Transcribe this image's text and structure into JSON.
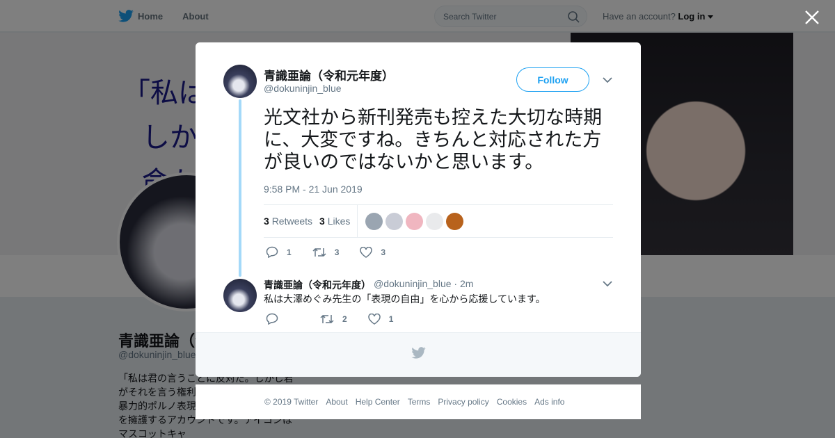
{
  "topnav": {
    "home_label": "Home",
    "about_label": "About",
    "search_placeholder": "Search Twitter",
    "account_prompt": "Have an account?",
    "login_label": "Log in"
  },
  "background_profile": {
    "banner_lines": [
      "「私は",
      "しか",
      "命た"
    ],
    "name": "青識亜論（令和元年度）",
    "handle": "@dokuninjin_blue",
    "bio": "「私は君の言うことに反対だ。しかし君がそれを言う権利は命をかけて守ろう」暴力的ポルノ表現も含めたすべての表現を擁護するアカウントです。アイコンはマスコットキャ"
  },
  "tweet": {
    "author_name": "青識亜論（令和元年度）",
    "author_handle": "@dokuninjin_blue",
    "follow_label": "Follow",
    "text": "光文社から新刊発売も控えた大切な時期に、大変ですね。きちんと対応された方が良いのではないかと思います。",
    "timestamp": "9:58 PM - 21 Jun 2019",
    "retweets_count": "3",
    "retweets_label": "Retweets",
    "likes_count": "3",
    "likes_label": "Likes",
    "liker_colors": [
      "#9aa5b1",
      "#c9ccd6",
      "#f0b6c0",
      "#e9eaec",
      "#b8621c"
    ],
    "actions": {
      "reply": "1",
      "retweet": "3",
      "like": "3"
    }
  },
  "reply": {
    "author_name": "青識亜論（令和元年度）",
    "author_handle": "@dokuninjin_blue",
    "time": "· 2m",
    "text": "私は大澤めぐみ先生の「表現の自由」を心から応援しています。",
    "actions": {
      "reply": "",
      "retweet": "2",
      "like": "1"
    }
  },
  "footer": {
    "copyright": "© 2019 Twitter",
    "links": [
      "About",
      "Help Center",
      "Terms",
      "Privacy policy",
      "Cookies",
      "Ads info"
    ]
  },
  "colors": {
    "accent": "#1da1f2",
    "thread_line": "#a4d9f9",
    "overlay": "rgba(0,0,0,0.5)"
  }
}
